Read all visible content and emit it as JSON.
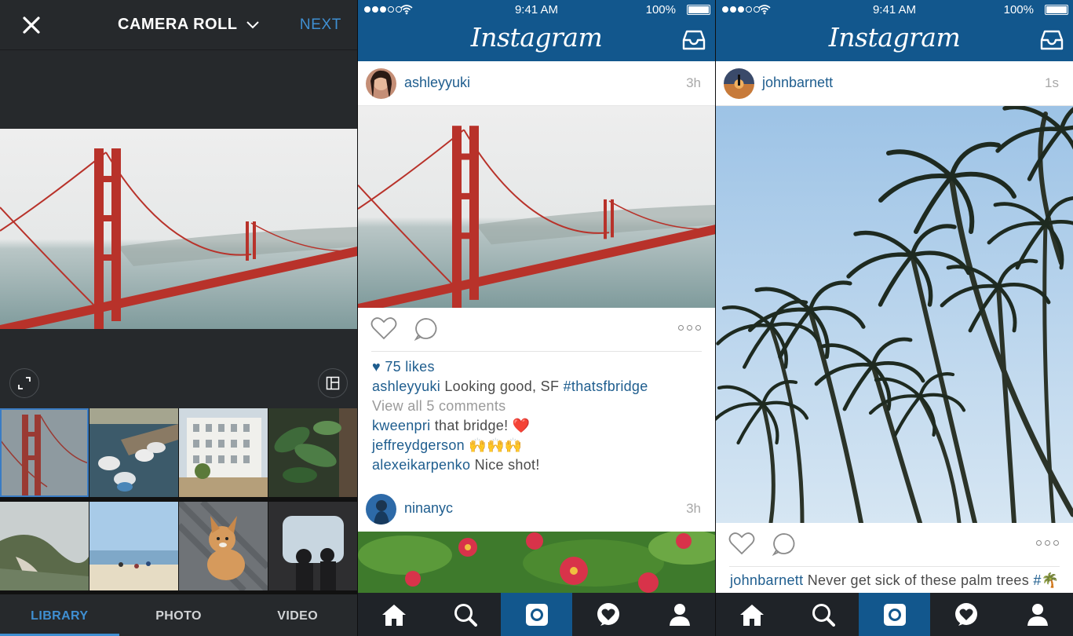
{
  "camera_roll": {
    "title": "CAMERA ROLL",
    "next_label": "NEXT",
    "tabs": [
      "LIBRARY",
      "PHOTO",
      "VIDEO"
    ],
    "active_tab": "LIBRARY",
    "thumbnails": [
      "golden-gate-bridge",
      "boats-at-dock",
      "white-building",
      "plants",
      "coastal-hills",
      "beach",
      "corgi-dog",
      "window-silhouettes"
    ]
  },
  "status_bar": {
    "time": "9:41 AM",
    "battery": "100%"
  },
  "app_logo": "Instagram",
  "feed_left": {
    "posts": [
      {
        "username": "ashleyyuki",
        "time_ago": "3h",
        "likes": "75 likes",
        "caption_user": "ashleyyuki",
        "caption_text": "Looking good, SF",
        "caption_tag": "#thatsfbridge",
        "view_comments": "View all 5 comments",
        "comments": [
          {
            "user": "kweenpri",
            "text": "that bridge! ❤️"
          },
          {
            "user": "jeffreydgerson",
            "text": "🙌🙌🙌"
          },
          {
            "user": "alexeikarpenko",
            "text": "Nice shot!"
          }
        ]
      },
      {
        "username": "ninanyc",
        "time_ago": "3h"
      }
    ]
  },
  "feed_right": {
    "post": {
      "username": "johnbarnett",
      "time_ago": "1s",
      "caption_user": "johnbarnett",
      "caption_text": "Never get sick of these palm trees",
      "caption_tag": "#🌴"
    }
  },
  "tabbar_icons": [
    "home-icon",
    "search-icon",
    "camera-icon",
    "activity-heart-icon",
    "profile-icon"
  ],
  "colors": {
    "header_blue": "#12578d",
    "link_blue": "#1e5d8e",
    "accent_blue": "#3f8fd2",
    "dark_bg": "#26292c",
    "tabbar_bg": "#1f2328"
  }
}
